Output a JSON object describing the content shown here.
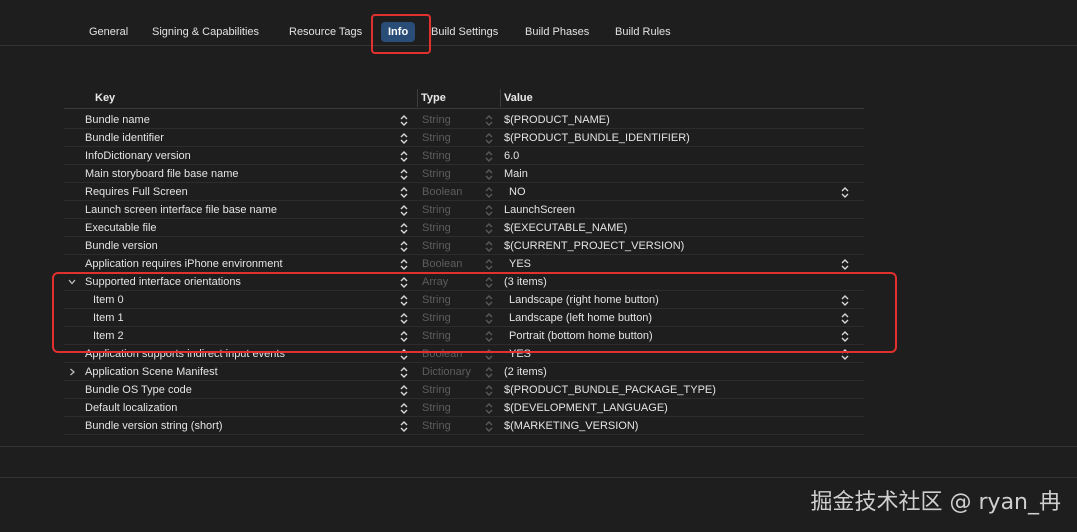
{
  "tabs": [
    {
      "label": "General"
    },
    {
      "label": "Signing & Capabilities"
    },
    {
      "label": "Resource Tags"
    },
    {
      "label": "Info"
    },
    {
      "label": "Build Settings"
    },
    {
      "label": "Build Phases"
    },
    {
      "label": "Build Rules"
    }
  ],
  "active_tab": "Info",
  "table": {
    "headers": {
      "key": "Key",
      "type": "Type",
      "value": "Value"
    },
    "rows": [
      {
        "key": "Bundle name",
        "type": "String",
        "value": "$(PRODUCT_NAME)"
      },
      {
        "key": "Bundle identifier",
        "type": "String",
        "value": "$(PRODUCT_BUNDLE_IDENTIFIER)"
      },
      {
        "key": "InfoDictionary version",
        "type": "String",
        "value": "6.0"
      },
      {
        "key": "Main storyboard file base name",
        "type": "String",
        "value": "Main"
      },
      {
        "key": "Requires Full Screen",
        "type": "Boolean",
        "value": "NO"
      },
      {
        "key": "Launch screen interface file base name",
        "type": "String",
        "value": "LaunchScreen"
      },
      {
        "key": "Executable file",
        "type": "String",
        "value": "$(EXECUTABLE_NAME)"
      },
      {
        "key": "Bundle version",
        "type": "String",
        "value": "$(CURRENT_PROJECT_VERSION)"
      },
      {
        "key": "Application requires iPhone environment",
        "type": "Boolean",
        "value": "YES"
      },
      {
        "key": "Supported interface orientations",
        "type": "Array",
        "value": "(3 items)"
      },
      {
        "key": "Item 0",
        "type": "String",
        "value": "Landscape (right home button)"
      },
      {
        "key": "Item 1",
        "type": "String",
        "value": "Landscape (left home button)"
      },
      {
        "key": "Item 2",
        "type": "String",
        "value": "Portrait (bottom home button)"
      },
      {
        "key": "Application supports indirect input events",
        "type": "Boolean",
        "value": "YES"
      },
      {
        "key": "Application Scene Manifest",
        "type": "Dictionary",
        "value": "(2 items)"
      },
      {
        "key": "Bundle OS Type code",
        "type": "String",
        "value": "$(PRODUCT_BUNDLE_PACKAGE_TYPE)"
      },
      {
        "key": "Default localization",
        "type": "String",
        "value": "$(DEVELOPMENT_LANGUAGE)"
      },
      {
        "key": "Bundle version string (short)",
        "type": "String",
        "value": "$(MARKETING_VERSION)"
      }
    ]
  },
  "watermark": "掘金技术社区 @ ryan_冉",
  "colors": {
    "highlight": "#e0312f",
    "active_tab": "#2a4d77",
    "background": "#1e1e1e"
  }
}
